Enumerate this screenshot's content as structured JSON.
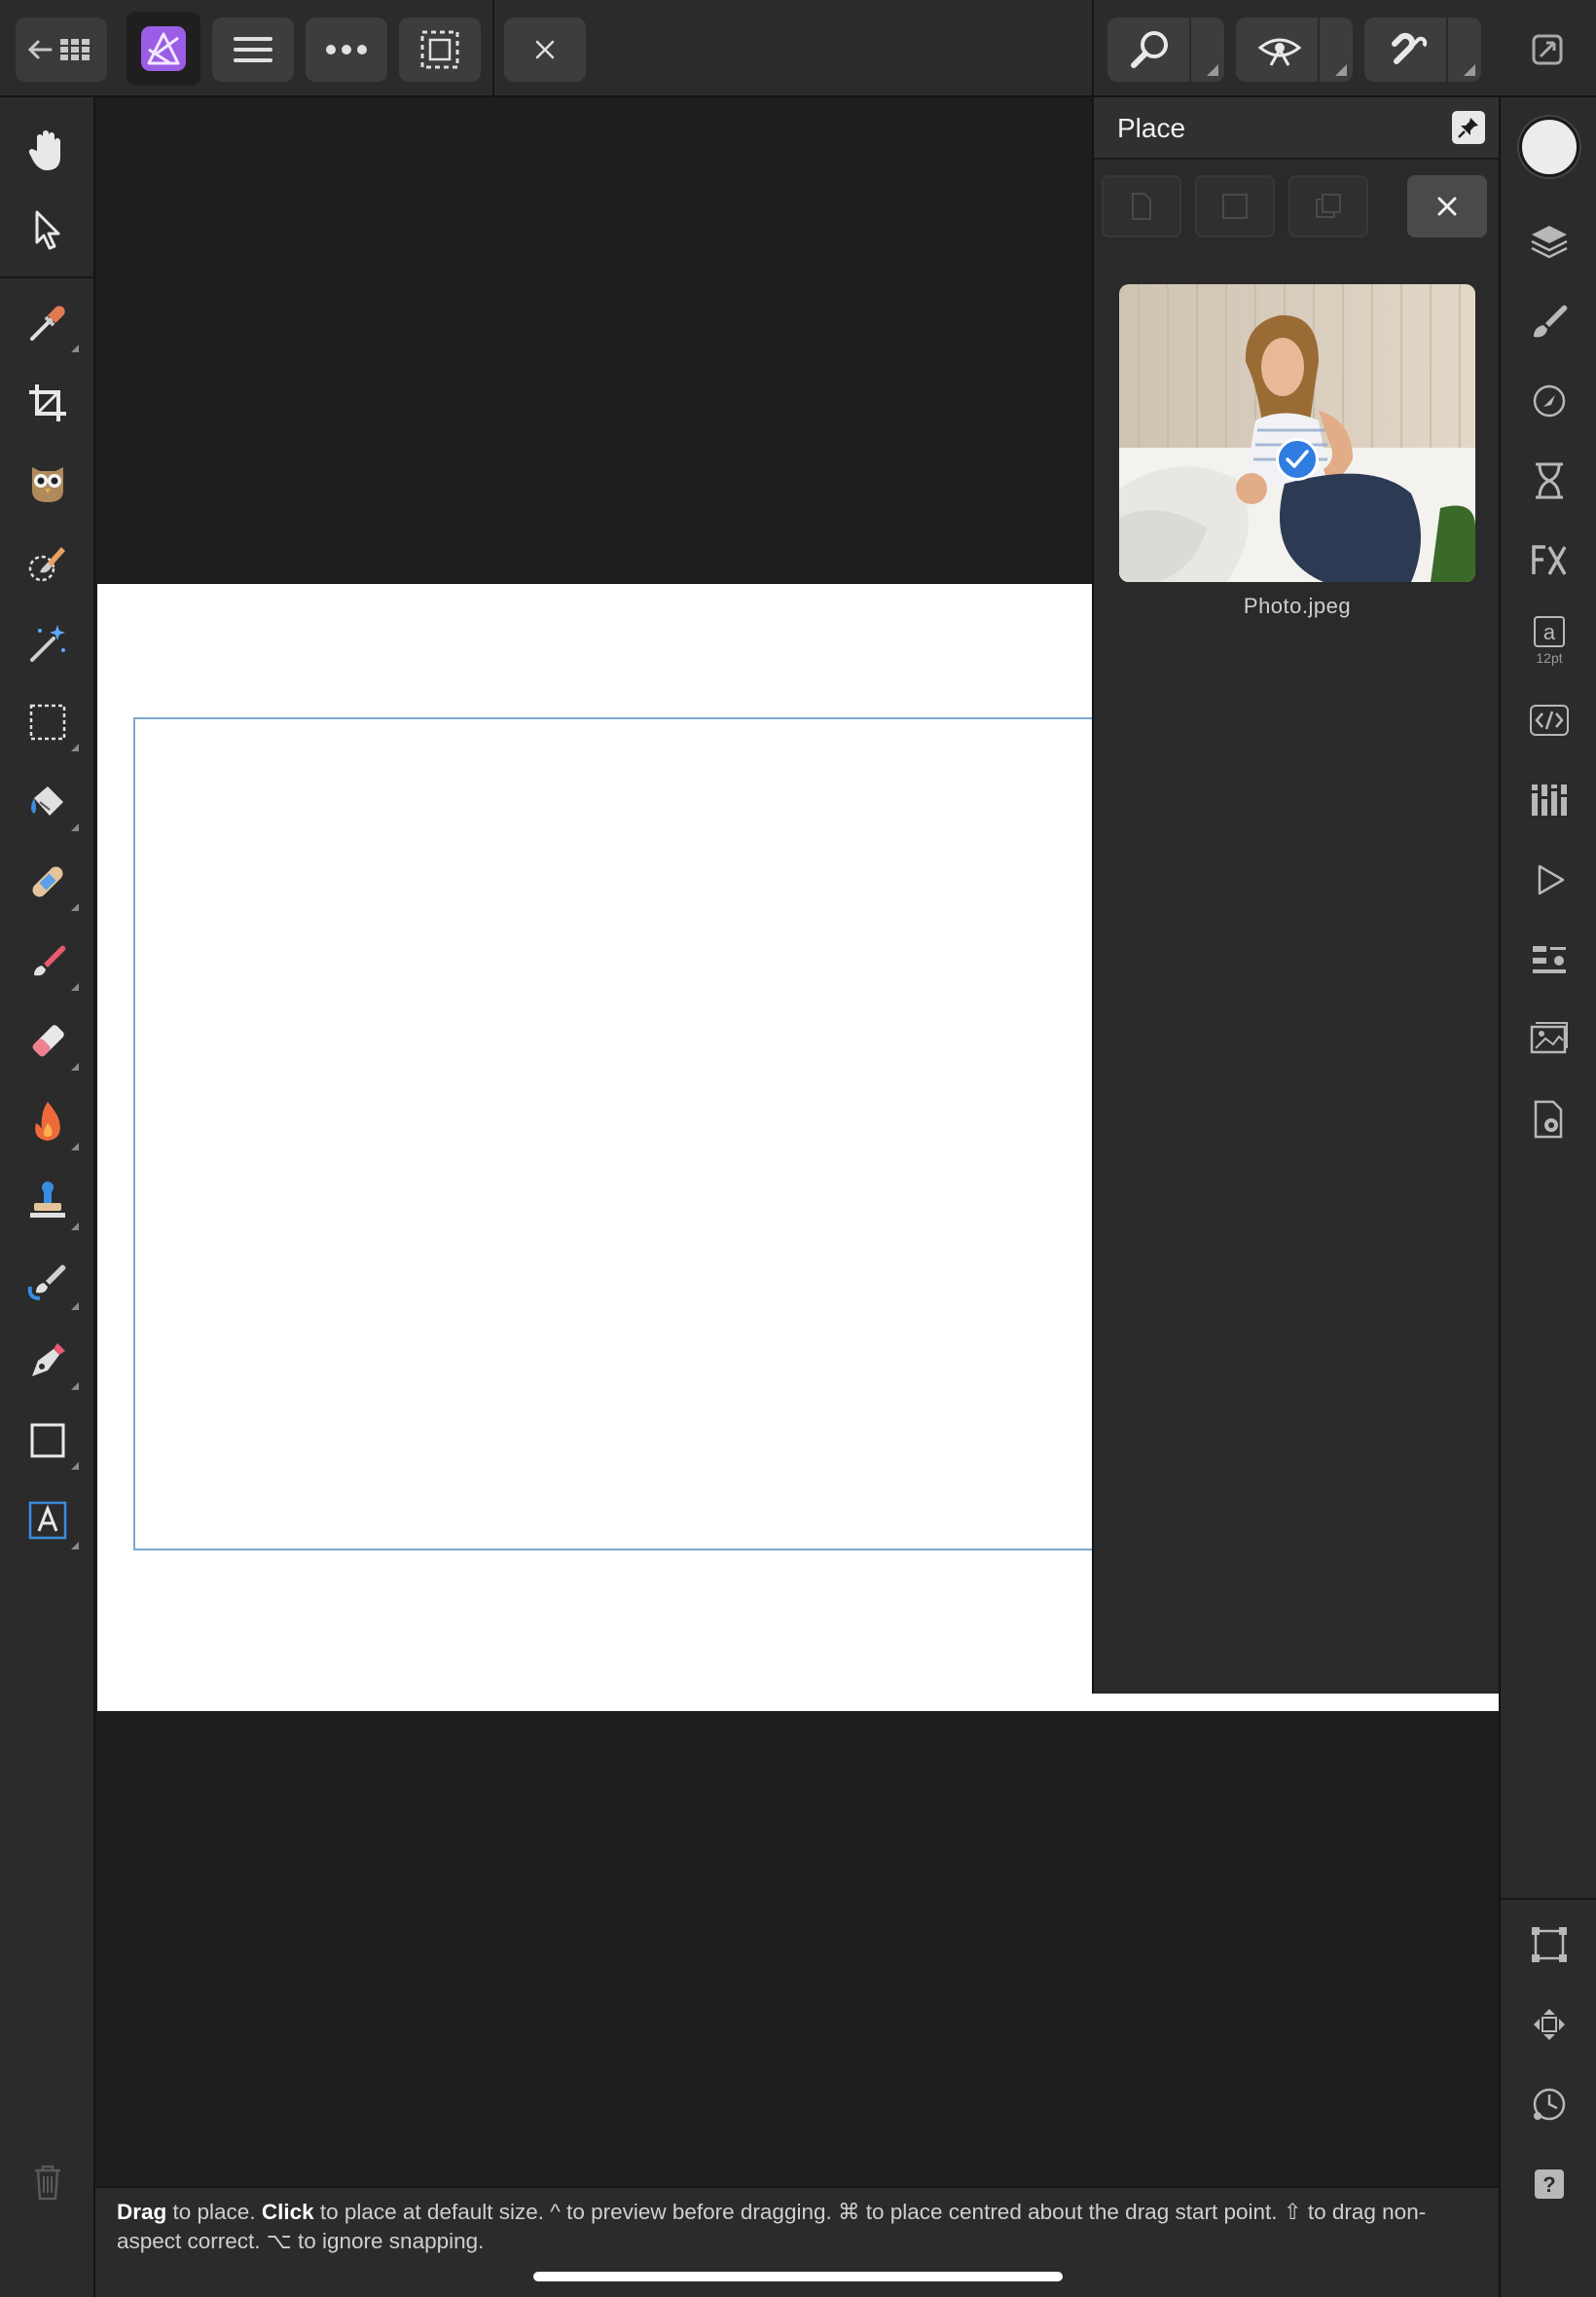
{
  "app": {
    "name": "Affinity Photo",
    "brand_color": "#9b5de5",
    "accent_color": "#2f7de1"
  },
  "toolbar": {
    "left": [
      {
        "name": "back-grid-button",
        "icon": "back-arrow-grid-icon"
      },
      {
        "name": "persona-button",
        "icon": "affinity-photo-logo"
      },
      {
        "name": "menu-button",
        "icon": "hamburger-icon"
      },
      {
        "name": "more-button",
        "icon": "ellipsis-icon"
      },
      {
        "name": "selection-mode-button",
        "icon": "marquee-icon"
      },
      {
        "name": "cancel-button",
        "icon": "close-icon"
      }
    ],
    "right": [
      {
        "name": "zoom-button",
        "icon": "magnifier-icon"
      },
      {
        "name": "view-mode-button",
        "icon": "eye-icon"
      },
      {
        "name": "snapping-button",
        "icon": "magnet-icon"
      },
      {
        "name": "expand-button",
        "icon": "expand-icon"
      }
    ]
  },
  "tools": [
    "view-tool-hand-icon",
    "move-tool-arrow-icon",
    "color-picker-icon",
    "crop-tool-icon",
    "red-eye-owl-icon",
    "selection-brush-icon",
    "magic-wand-icon",
    "marquee-selection-icon",
    "flood-fill-icon",
    "inpainting-bandage-icon",
    "paint-brush-icon",
    "erase-brush-icon",
    "dodge-burn-flame-icon",
    "clone-stamp-icon",
    "smudge-brush-icon",
    "pen-tool-icon",
    "rectangle-tool-icon",
    "text-tool-icon"
  ],
  "place_panel": {
    "title": "Place",
    "item": {
      "filename": "Photo.jpeg",
      "selected": true
    }
  },
  "studio": {
    "text_size_label": "12pt",
    "swatch_color": "#ececec"
  },
  "status": {
    "parts": [
      {
        "bold": true,
        "text": "Drag"
      },
      {
        "bold": false,
        "text": " to place. "
      },
      {
        "bold": true,
        "text": "Click"
      },
      {
        "bold": false,
        "text": " to place at default size. ^ to preview before dragging. ⌘ to place centred about the drag start point. ⇧ to drag non-aspect correct. ⌥ to ignore snapping."
      }
    ]
  }
}
